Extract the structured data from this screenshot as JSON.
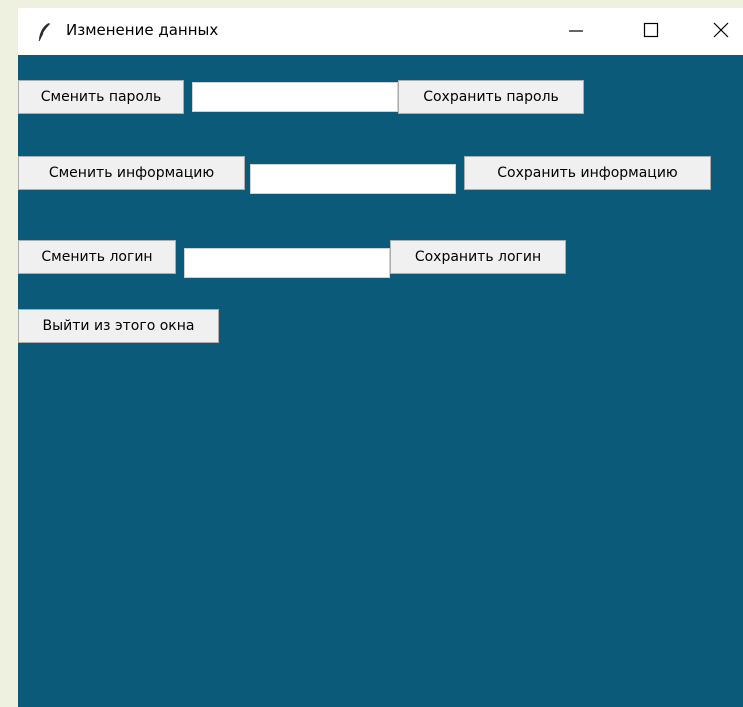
{
  "window": {
    "title": "Изменение данных",
    "background_color": "#0c5a7a",
    "icons": {
      "app": "feather-icon",
      "minimize": "minimize-icon",
      "maximize": "maximize-icon",
      "close": "close-icon"
    }
  },
  "password_row": {
    "change_label": "Сменить пароль",
    "input_value": "",
    "save_label": "Сохранить пароль"
  },
  "info_row": {
    "change_label": "Сменить информацию",
    "input_value": "",
    "save_label": "Сохранить информацию"
  },
  "login_row": {
    "change_label": "Сменить логин",
    "input_value": "",
    "save_label": "Сохранить логин"
  },
  "exit_button": {
    "label": "Выйти из этого окна"
  }
}
